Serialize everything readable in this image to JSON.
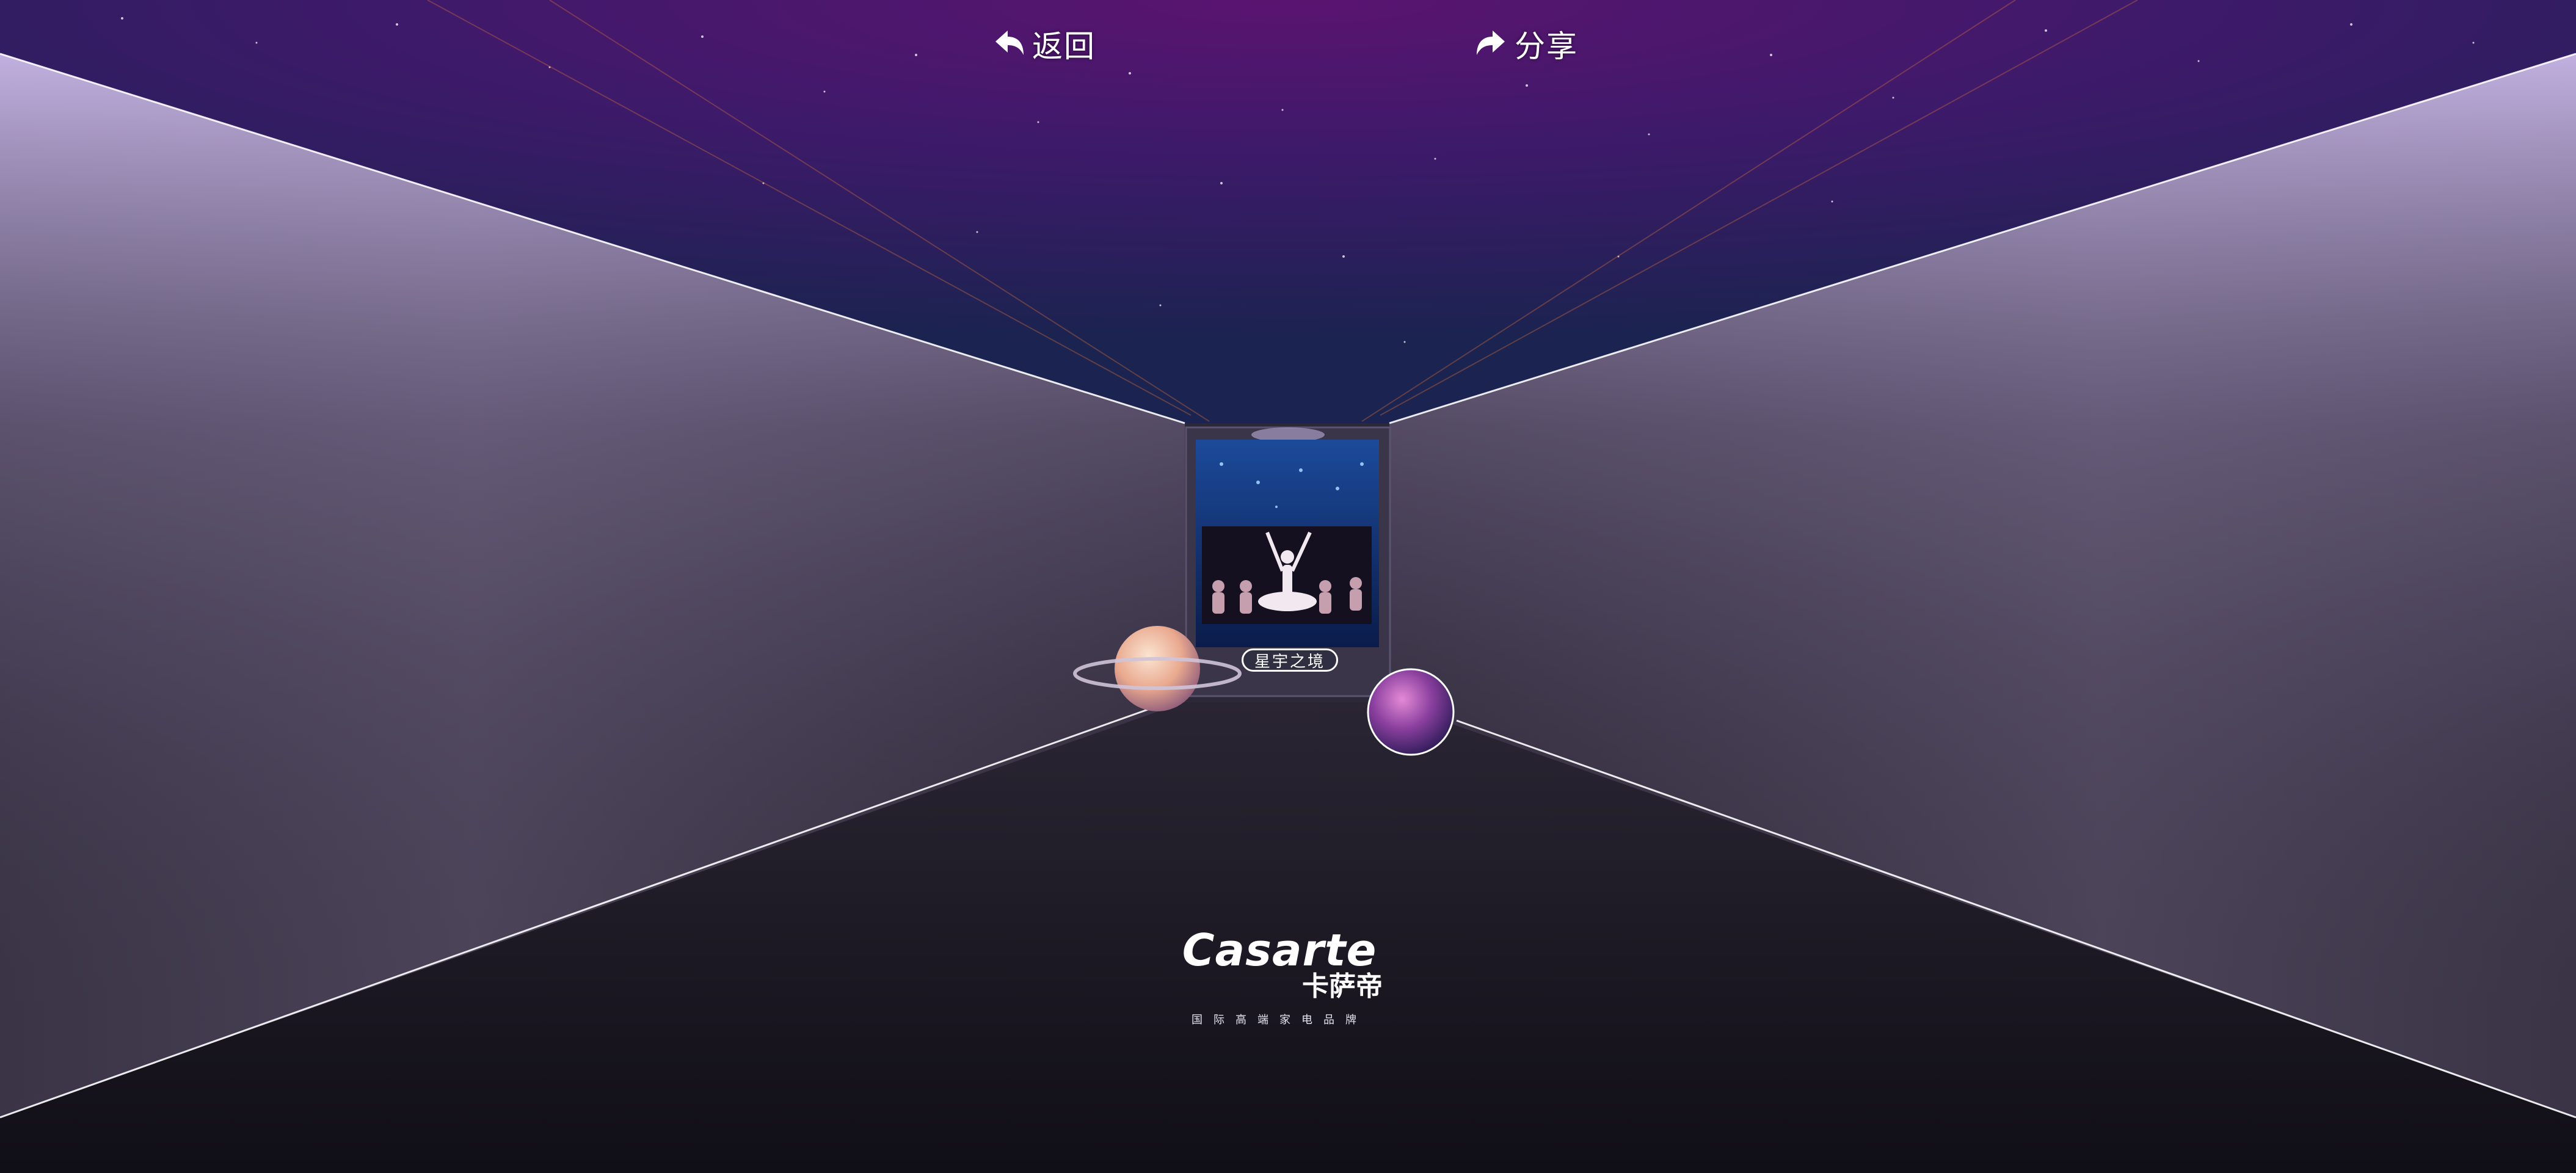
{
  "nav": {
    "back_label": "返回",
    "back_icon": "back-arrow-icon",
    "share_label": "分享",
    "share_icon": "share-arrow-icon"
  },
  "exhibit": {
    "label": "星宇之境"
  },
  "brand": {
    "name": "Casarte",
    "name_cn": "卡萨帝",
    "tagline": "国际高端家电品牌"
  },
  "colors": {
    "ceiling_purple": "#4a1a6e",
    "wall_lavender": "#b9a6dc",
    "floor_dark": "#17141f",
    "accent_white": "#ffffff"
  }
}
